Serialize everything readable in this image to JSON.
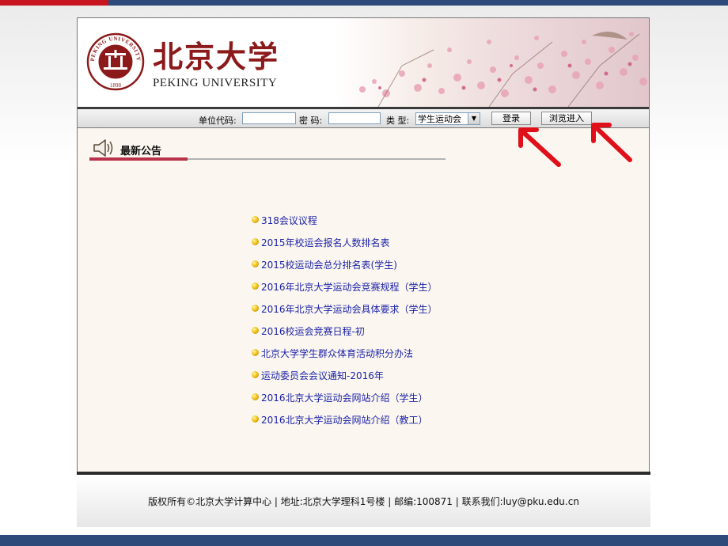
{
  "header": {
    "logo_cn": "北京大学",
    "logo_en": "PEKING UNIVERSITY",
    "seal_text_top": "PEKING UNIVERSITY",
    "seal_year": "1898"
  },
  "login": {
    "unit_code_label": "单位代码:",
    "password_label": "密 码:",
    "type_label": "类 型:",
    "unit_code_value": "",
    "password_value": "",
    "type_selected": "学生运动会",
    "login_button": "登录",
    "browse_button": "浏览进入"
  },
  "news": {
    "title": "最新公告",
    "items": [
      "318会议议程",
      "2015年校运会报名人数排名表",
      "2015校运动会总分排名表(学生)",
      "2016年北京大学运动会竞赛规程（学生）",
      "2016年北京大学运动会具体要求（学生）",
      "2016校运会竞赛日程-初",
      "北京大学学生群众体育活动积分办法",
      "运动委员会会议通知-2016年",
      "2016北京大学运动会网站介绍（学生）",
      "2016北京大学运动会网站介绍（教工）"
    ]
  },
  "footer": {
    "text": "版权所有©北京大学计算中心 | 地址:北京大学理科1号楼 | 邮编:100871 | 联系我们:luy@pku.edu.cn"
  },
  "colors": {
    "brand_red": "#8c1a1a",
    "link_blue": "#1a1fa8",
    "slide_blue": "#2e4a7a",
    "slide_red": "#c8141e",
    "annotation_arrow": "#e0101a"
  },
  "icons": {
    "news": "speaker-icon",
    "bullet": "bullet-dot-icon",
    "seal": "university-seal-icon"
  }
}
